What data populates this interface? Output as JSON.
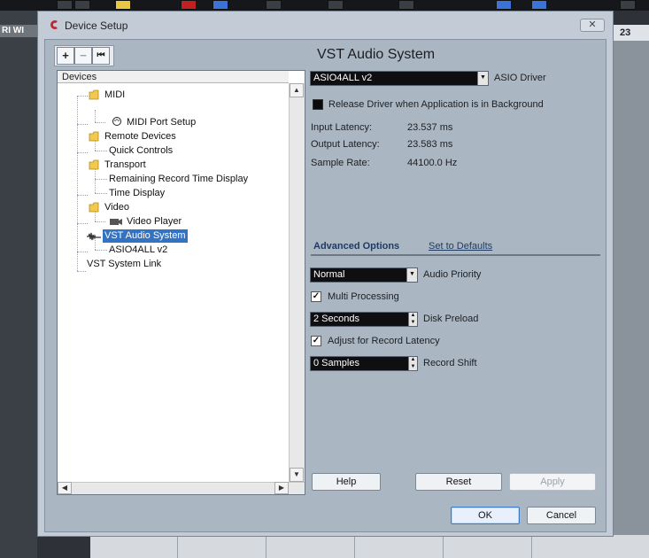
{
  "background": {
    "ruler_number": "23",
    "left_strip_label": "RI WI"
  },
  "dialog": {
    "title": "Device Setup",
    "close_label": "✕",
    "toolbar": {
      "add": "+",
      "remove": "−",
      "reset": "⏮"
    },
    "tree": {
      "header": "Devices",
      "items": [
        {
          "label": "MIDI"
        },
        {
          "label": "MIDI Port Setup"
        },
        {
          "label": "Remote Devices"
        },
        {
          "label": "Quick Controls"
        },
        {
          "label": "Transport"
        },
        {
          "label": "Remaining Record Time Display"
        },
        {
          "label": "Time Display"
        },
        {
          "label": "Video"
        },
        {
          "label": "Video Player"
        },
        {
          "label": "VST Audio System"
        },
        {
          "label": "ASIO4ALL v2"
        },
        {
          "label": "VST System Link"
        }
      ],
      "selected": "VST Audio System"
    },
    "panel": {
      "title": "VST Audio System",
      "driver_value": "ASIO4ALL v2",
      "driver_label": "ASIO Driver",
      "release_driver_label": "Release Driver when Application is in Background",
      "release_driver_checked": false,
      "input_latency_label": "Input Latency:",
      "input_latency_value": "23.537 ms",
      "output_latency_label": "Output Latency:",
      "output_latency_value": "23.583 ms",
      "sample_rate_label": "Sample Rate:",
      "sample_rate_value": "44100.0 Hz",
      "tab_advanced": "Advanced Options",
      "tab_defaults": "Set to Defaults",
      "audio_priority_value": "Normal",
      "audio_priority_label": "Audio Priority",
      "multi_processing_label": "Multi Processing",
      "multi_processing_checked": true,
      "disk_preload_value": "2 Seconds",
      "disk_preload_label": "Disk Preload",
      "adjust_latency_label": "Adjust for Record Latency",
      "adjust_latency_checked": true,
      "record_shift_value": "0 Samples",
      "record_shift_label": "Record Shift"
    },
    "buttons": {
      "help": "Help",
      "reset": "Reset",
      "apply": "Apply",
      "ok": "OK",
      "cancel": "Cancel"
    },
    "colors": {
      "dialog_bg": "#c3ccd6",
      "client_bg": "#aab6c2",
      "selection": "#3373c4",
      "folder": "#f2c94c",
      "field_bg": "#0f0f12"
    }
  }
}
